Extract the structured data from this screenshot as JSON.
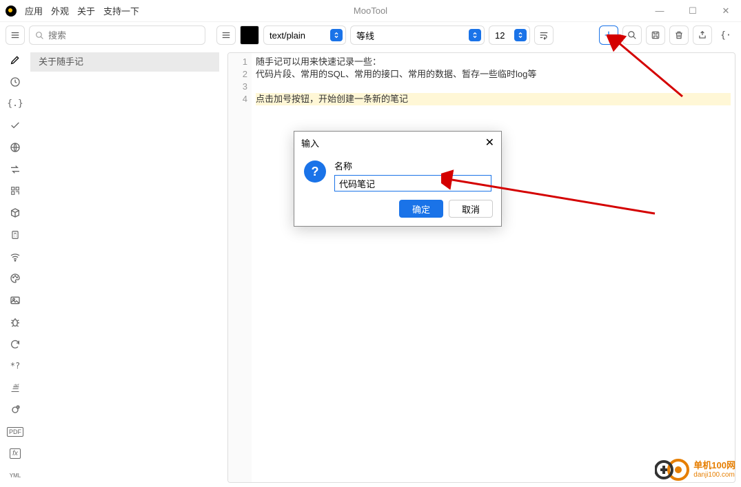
{
  "app_title": "MooTool",
  "menu": {
    "app": "应用",
    "appearance": "外观",
    "about": "关于",
    "support": "支持一下"
  },
  "search": {
    "placeholder": "搜索"
  },
  "editor_toolbar": {
    "type": "text/plain",
    "font": "等线",
    "size": "12"
  },
  "sidebar_list": {
    "item1": "关于随手记"
  },
  "editor_lines": {
    "l1": "随手记可以用来快速记录一些：",
    "l2": "代码片段、常用的SQL、常用的接口、常用的数据、暂存一些临时log等",
    "l3": "",
    "l4": "点击加号按钮，开始创建一条新的笔记"
  },
  "line_numbers": {
    "n1": "1",
    "n2": "2",
    "n3": "3",
    "n4": "4"
  },
  "modal": {
    "title": "输入",
    "label": "名称",
    "value": "代码笔记",
    "ok": "确定",
    "cancel": "取消"
  },
  "watermark": {
    "brand": "单机100网",
    "url": "danji100.com"
  },
  "side_icons": [
    "pencil-icon",
    "clock-icon",
    "braces-icon",
    "check-icon",
    "globe-icon",
    "transfer-icon",
    "qrcode-icon",
    "cube-icon",
    "calc-icon",
    "wifi-icon",
    "palette-icon",
    "image-icon",
    "bug-icon",
    "refresh-icon",
    "regex-icon",
    "java-icon",
    "cron-icon",
    "pdf-icon",
    "fx-icon",
    "yaml-icon"
  ],
  "right_icons": [
    "plus-icon",
    "search-icon",
    "save-icon",
    "trash-icon",
    "share-icon",
    "bracket-icon"
  ]
}
